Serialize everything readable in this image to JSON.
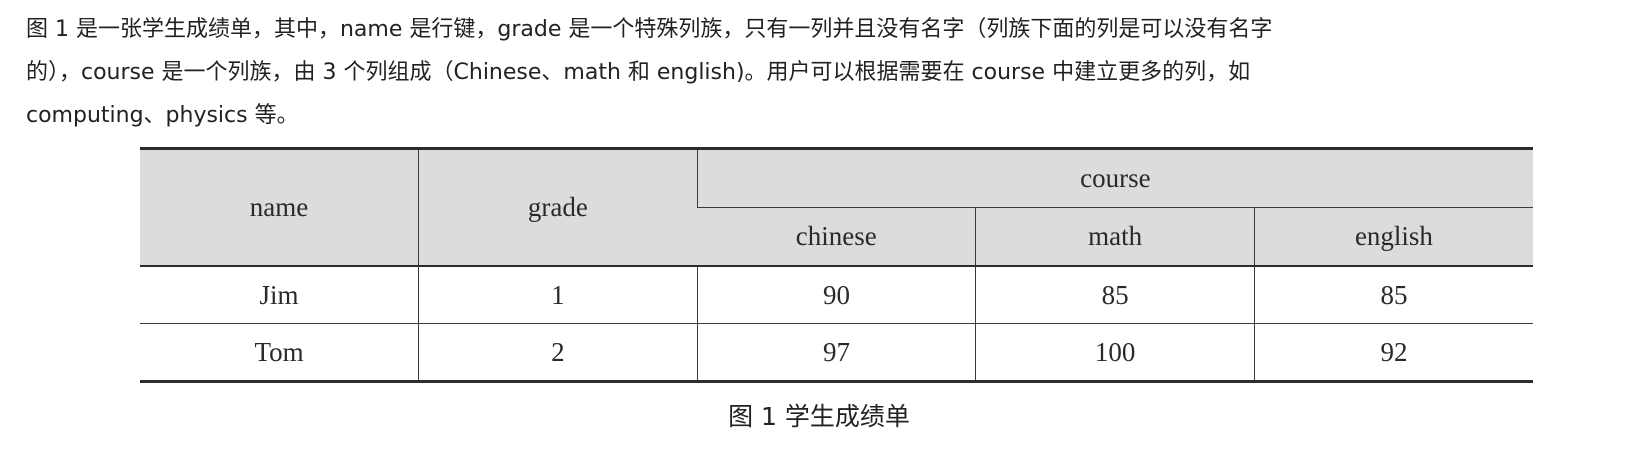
{
  "paragraph": {
    "lines": [
      "图 1 是一张学生成绩单，其中，name 是行键，grade 是一个特殊列族，只有一列并且没有名字（列族下面的列是可以没有名字",
      "的），course 是一个列族，由 3 个列组成（Chinese、math 和 english)。用户可以根据需要在 course 中建立更多的列，如",
      "computing、physics 等。"
    ]
  },
  "table": {
    "headers": {
      "name": "name",
      "grade": "grade",
      "course": "course",
      "course_columns": [
        "chinese",
        "math",
        "english"
      ]
    },
    "rows": [
      {
        "name": "Jim",
        "grade": "1",
        "chinese": "90",
        "math": "85",
        "english": "85"
      },
      {
        "name": "Tom",
        "grade": "2",
        "chinese": "97",
        "math": "100",
        "english": "92"
      }
    ]
  },
  "caption": "图 1  学生成绩单"
}
